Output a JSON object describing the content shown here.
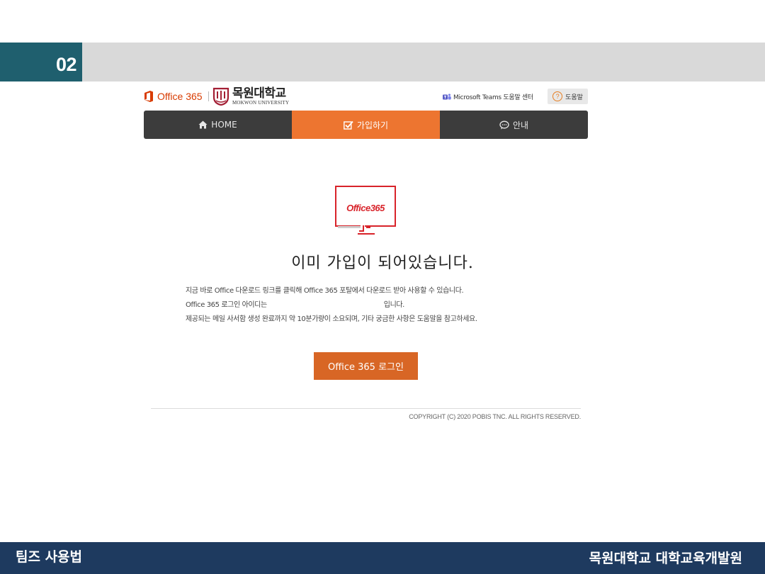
{
  "slide": {
    "number": "02"
  },
  "header": {
    "office_logo": "Office 365",
    "university_name": "목원대학교",
    "university_name_en": "MOKWON UNIVERSITY",
    "teams_help_link": "Microsoft Teams 도움말 센터",
    "help_button": "도움말"
  },
  "nav": {
    "tabs": [
      {
        "label": "HOME",
        "icon": "home-icon",
        "active": false
      },
      {
        "label": "가입하기",
        "icon": "checkbox-icon",
        "active": true
      },
      {
        "label": "안내",
        "icon": "chat-icon",
        "active": false
      }
    ]
  },
  "content": {
    "logo_text": "Office365",
    "heading": "이미 가입이 되어있습니다.",
    "desc_line1": "지금 바로 Office 다운로드 링크를 클릭해 Office 365 포탈에서 다운로드 받아 사용할 수 있습니다.",
    "desc_line2_start": "Office 365 로그인 아이디는",
    "desc_line2_end": "입니다.",
    "desc_line3": "제공되는 메일 사서함 생성 완료까지 약 10분가량이 소요되며, 기타 궁금한 사항은 도움말을 참고하세요.",
    "login_button": "Office 365 로그인",
    "copyright": "COPYRIGHT (C) 2020 POBIS TNC. ALL RIGHTS RESERVED."
  },
  "footer": {
    "left": "팀즈 사용법",
    "right": "목원대학교 대학교육개발원"
  },
  "colors": {
    "accent_orange": "#ed7530",
    "button_orange": "#d86625",
    "office_red": "#d83b01",
    "footer_navy": "#1e3a5f",
    "slide_teal": "#1f5f6e"
  }
}
